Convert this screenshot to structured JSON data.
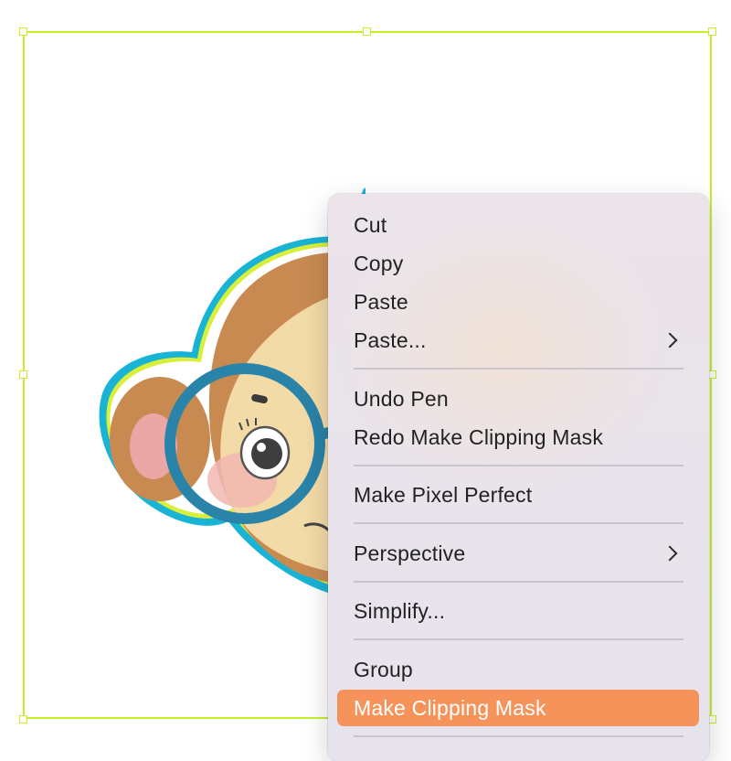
{
  "menu": {
    "items": [
      {
        "label": "Cut"
      },
      {
        "label": "Copy"
      },
      {
        "label": "Paste"
      },
      {
        "label": "Paste...",
        "submenu": true
      },
      {
        "label": "Undo Pen"
      },
      {
        "label": "Redo Make Clipping Mask"
      },
      {
        "label": "Make Pixel Perfect"
      },
      {
        "label": "Perspective",
        "submenu": true
      },
      {
        "label": "Simplify..."
      },
      {
        "label": "Group"
      },
      {
        "label": "Make Clipping Mask",
        "highlighted": true
      }
    ]
  },
  "colors": {
    "selection": "#c6ef2a",
    "highlight": "#f5935a",
    "outline": "#19b3d6",
    "menu_bg": "#e8e3ec"
  },
  "icons": [
    "chevron-right-icon"
  ]
}
